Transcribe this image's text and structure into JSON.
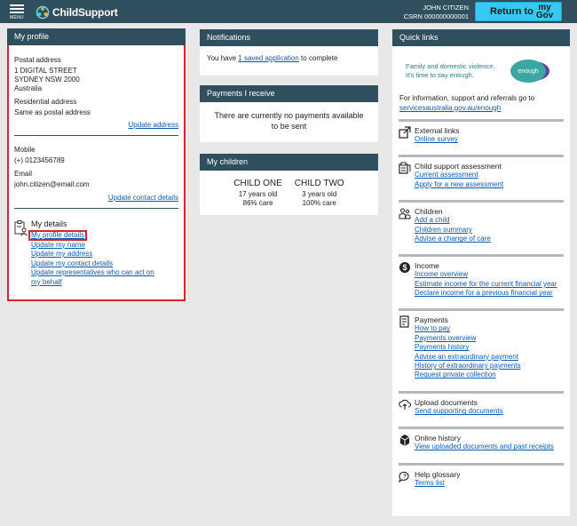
{
  "topbar": {
    "menu_label": "MENU",
    "app_name": "ChildSupport",
    "user_name": "JOHN CITIZEN",
    "csrn": "CSRN 000000000001",
    "return_label": "Return to",
    "mygov_top": "my",
    "mygov_bottom": "Gov"
  },
  "profile": {
    "title": "My profile",
    "postal_label": "Postal address",
    "postal_lines": [
      "1 DIGITAL STREET",
      "SYDNEY NSW 2000",
      "Australia"
    ],
    "residential_label": "Residential address",
    "residential_value": "Same as postal address",
    "update_address": "Update address",
    "mobile_label": "Mobile",
    "mobile_value": "(+) 0123456789",
    "email_label": "Email",
    "email_value": "john.citizen@email.com",
    "update_contact": "Update contact details",
    "my_details_title": "My details",
    "detail_links": [
      "My profile details",
      "Update my name",
      "Update my address",
      "Update my contact details",
      "Update representatives who can act on my behalf"
    ]
  },
  "notifications": {
    "title": "Notifications",
    "text_before": "You have ",
    "link": "1 saved application",
    "text_after": " to complete"
  },
  "payments": {
    "title": "Payments I receive",
    "message": "There are currently no payments available to be sent"
  },
  "children": {
    "title": "My children",
    "items": [
      {
        "name": "CHILD ONE",
        "age": "17 years old",
        "care": "86% care"
      },
      {
        "name": "CHILD TWO",
        "age": "3 years old",
        "care": "100% care"
      }
    ]
  },
  "quick": {
    "title": "Quick links",
    "banner_line1": "Family and domestic violence.",
    "banner_line2": "It's time to say enough.",
    "banner_badge": "enough",
    "info_text": "For information, support and referrals go to",
    "info_link": "servicesaustralia.gov.au/enough",
    "sections": [
      {
        "icon": "external-link-icon",
        "title": "External links",
        "links": [
          "Online survey"
        ]
      },
      {
        "icon": "assessment-icon",
        "title": "Child support assessment",
        "links": [
          "Current assessment",
          "Apply for a new assessment"
        ]
      },
      {
        "icon": "children-icon",
        "title": "Children",
        "links": [
          "Add a child",
          "Children summary",
          "Advise a change of care"
        ]
      },
      {
        "icon": "dollar-icon",
        "title": "Income",
        "links": [
          "Income overview",
          "Estimate income for the current financial year",
          "Declare income for a previous financial year"
        ]
      },
      {
        "icon": "payments-icon",
        "title": "Payments",
        "links": [
          "How to pay",
          "Payments overview",
          "Payments history",
          "Advise an extraordinary payment",
          "History of extraordinary payments",
          "Request private collection"
        ]
      },
      {
        "icon": "upload-icon",
        "title": "Upload documents",
        "links": [
          "Send supporting documents"
        ]
      },
      {
        "icon": "history-icon",
        "title": "Online history",
        "links": [
          "View uploaded documents and past receipts"
        ]
      },
      {
        "icon": "help-icon",
        "title": "Help glossary",
        "links": [
          "Terms list"
        ]
      }
    ]
  },
  "colors": {
    "header": "#2f4f5f",
    "accent": "#37c9f0",
    "link": "#0b5bb5",
    "highlight": "#d9232d"
  }
}
